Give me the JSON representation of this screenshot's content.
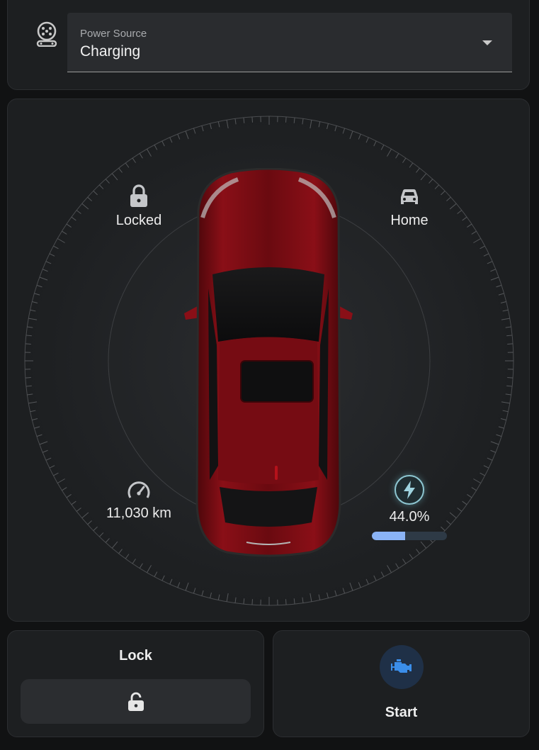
{
  "power_source": {
    "icon": "ev-plug-icon",
    "label": "Power Source",
    "value": "Charging"
  },
  "vehicle": {
    "lock_status": {
      "icon": "lock-icon",
      "label": "Locked"
    },
    "location": {
      "icon": "car-icon",
      "label": "Home"
    },
    "odometer": {
      "icon": "speedometer-icon",
      "label": "11,030 km"
    },
    "battery": {
      "icon": "lightning-bolt-icon",
      "label": "44.0%",
      "level": 0.44,
      "ring_color": "#8ec6d1",
      "bar_color": "#8ab3f5"
    },
    "car_color": "#8a0f17"
  },
  "actions": {
    "lock": {
      "title": "Lock",
      "icon": "lock-open-icon"
    },
    "start": {
      "title": "Start",
      "icon": "engine-icon",
      "icon_color": "#3b8eea"
    }
  }
}
